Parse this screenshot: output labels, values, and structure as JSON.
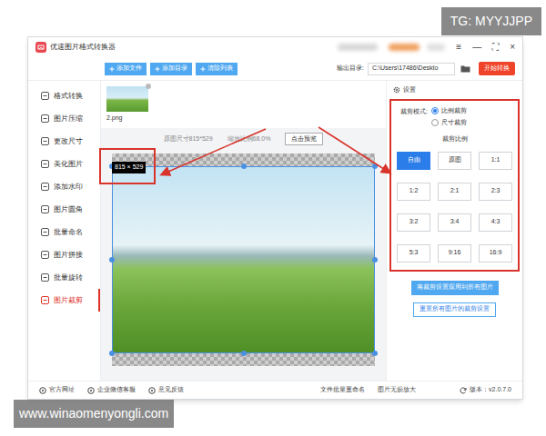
{
  "watermarks": {
    "top": "TG: MYYJJPP",
    "bottom": "www.winaomenyongli.com"
  },
  "window": {
    "title": "优速图片格式转换器",
    "controls": [
      "≡",
      "—",
      "⛶",
      "×"
    ]
  },
  "toolbar": {
    "buttons": [
      "添加文件",
      "添加目录",
      "清除列表"
    ],
    "output_label": "输出目录:",
    "output_path": "C:\\Users\\17486\\Deskto",
    "start": "开始转换"
  },
  "sidebar": {
    "items": [
      {
        "label": "格式转换",
        "selected": false
      },
      {
        "label": "图片压缩",
        "selected": false
      },
      {
        "label": "更改尺寸",
        "selected": false
      },
      {
        "label": "美化图片",
        "selected": false
      },
      {
        "label": "添加水印",
        "selected": false
      },
      {
        "label": "图片圆角",
        "selected": false
      },
      {
        "label": "批量命名",
        "selected": false
      },
      {
        "label": "图片拼接",
        "selected": false
      },
      {
        "label": "批量旋转",
        "selected": false
      },
      {
        "label": "图片裁剪",
        "selected": true
      }
    ]
  },
  "file": {
    "name": "2.png"
  },
  "preview": {
    "original_size": "原图尺寸815*529",
    "scale": "缩放比例68.0%",
    "preview_button": "点击预览",
    "badge": "815 × 529"
  },
  "settings": {
    "title": "设置",
    "mode_label": "裁剪模式:",
    "modes": [
      {
        "label": "比例裁剪",
        "selected": true
      },
      {
        "label": "尺寸裁剪",
        "selected": false
      }
    ],
    "ratio_title": "裁剪比例",
    "ratios": [
      {
        "label": "自由",
        "selected": true
      },
      {
        "label": "原图",
        "selected": false
      },
      {
        "label": "1:1",
        "selected": false
      },
      {
        "label": "1:2",
        "selected": false
      },
      {
        "label": "2:1",
        "selected": false
      },
      {
        "label": "2:3",
        "selected": false
      },
      {
        "label": "3:2",
        "selected": false
      },
      {
        "label": "3:4",
        "selected": false
      },
      {
        "label": "4:3",
        "selected": false
      },
      {
        "label": "5:3",
        "selected": false
      },
      {
        "label": "9:16",
        "selected": false
      },
      {
        "label": "16:9",
        "selected": false
      }
    ],
    "apply": "将裁剪设置应用到所有图片",
    "reset": "重置所有图片的裁剪设置"
  },
  "status_bar": {
    "links": [
      "官方网址",
      "企业微信客服",
      "意见反馈"
    ],
    "tools": [
      "文件批量重命名",
      "图片无损放大"
    ],
    "version": "版本：v2.0.7.0"
  }
}
